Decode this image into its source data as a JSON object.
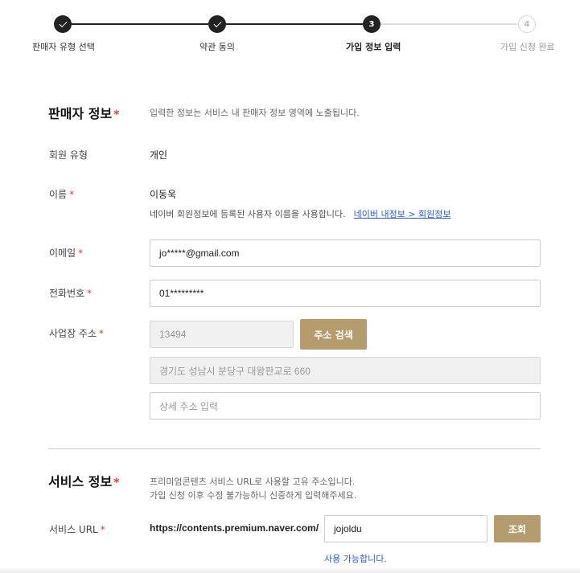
{
  "stepper": {
    "steps": [
      {
        "number": "1",
        "label": "판매자 유형 선택",
        "state": "done"
      },
      {
        "number": "2",
        "label": "약관 동의",
        "state": "done"
      },
      {
        "number": "3",
        "label": "가입 정보 입력",
        "state": "active"
      },
      {
        "number": "4",
        "label": "가입 신청 완료",
        "state": "todo"
      }
    ]
  },
  "seller_info": {
    "title": "판매자 정보",
    "required_mark": "*",
    "description": "입력한 정보는 서비스 내 판매자 정보 영역에 노출됩니다.",
    "member_type": {
      "label": "회원 유형",
      "value": "개인"
    },
    "name": {
      "label": "이름",
      "value": "이동욱",
      "hint": "네이버 회원정보에 등록된 사용자 이름을 사용합니다.",
      "hint_link": "네이버 내정보 > 회원정보"
    },
    "email": {
      "label": "이메일",
      "value": "jo*****@gmail.com"
    },
    "phone": {
      "label": "전화번호",
      "value": "01*********"
    },
    "address": {
      "label": "사업장 주소",
      "zipcode": "13494",
      "search_button": "주소 검색",
      "road_address": "경기도 성남시 분당구 대왕판교로 660",
      "detail_placeholder": "상세 주소 입력"
    }
  },
  "service_info": {
    "title": "서비스 정보",
    "required_mark": "*",
    "description_line1": "프리미엄콘텐츠 서비스 URL로 사용할 고유 주소입니다.",
    "description_line2": "가입 신청 이후 수정 불가능하니 신중하게 입력해주세요.",
    "url": {
      "label": "서비스 URL",
      "prefix": "https://contents.premium.naver.com/",
      "value": "jojoldu",
      "check_button": "조회",
      "status": "사용 가능합니다."
    }
  },
  "colors": {
    "accent": "#b49c6f",
    "required": "#e53935",
    "link": "#2a5ad8",
    "step_active": "#222222"
  }
}
